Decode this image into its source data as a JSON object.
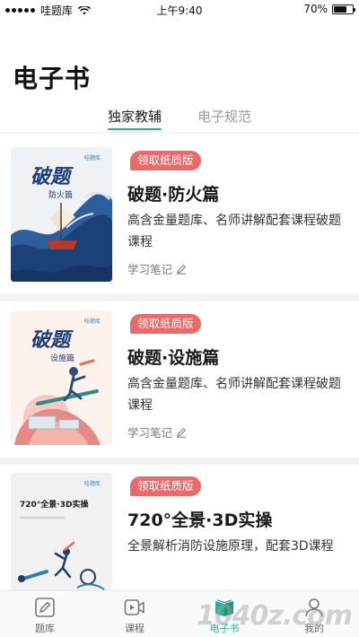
{
  "status_bar": {
    "carrier": "哇题库",
    "time": "上午9:40",
    "battery": "70%",
    "battery_level": 0.7
  },
  "page": {
    "title": "电子书"
  },
  "tabs": [
    {
      "label": "独家教辅",
      "active": true
    },
    {
      "label": "电子规范",
      "active": false
    }
  ],
  "books": [
    {
      "badge": "领取纸质版",
      "title": "破题·防火篇",
      "description": "高含金量题库、名师讲解配套课程破题课程",
      "note": "学习笔记",
      "cover": {
        "brand": "哇题库",
        "title_chars": "破题",
        "subtitle": "防火篇",
        "icon": "ship-wave-illustration"
      }
    },
    {
      "badge": "领取纸质版",
      "title": "破题·设施篇",
      "description": "高含金量题库、名师讲解配套课程破题课程",
      "note": "学习笔记",
      "cover": {
        "brand": "哇题库",
        "title_chars": "破题",
        "subtitle": "设施篇",
        "icon": "surfer-illustration"
      }
    },
    {
      "badge": "领取纸质版",
      "title": "720°全景·3D实操",
      "description": "全景解析消防设施原理，配套3D课程",
      "note": "",
      "cover": {
        "brand": "哇题库",
        "title_chars": "720°全景·3D实操",
        "subtitle": "",
        "icon": "swimmers-illustration"
      }
    }
  ],
  "bottom_nav": [
    {
      "label": "题库",
      "icon": "pencil-icon",
      "active": false
    },
    {
      "label": "课程",
      "icon": "video-icon",
      "active": false
    },
    {
      "label": "电子书",
      "icon": "book-icon",
      "active": true
    },
    {
      "label": "我的",
      "icon": "user-icon",
      "active": false
    }
  ],
  "colors": {
    "accent": "#2bb08f",
    "badge": "#e96a6a"
  },
  "watermark": "1040z.com"
}
